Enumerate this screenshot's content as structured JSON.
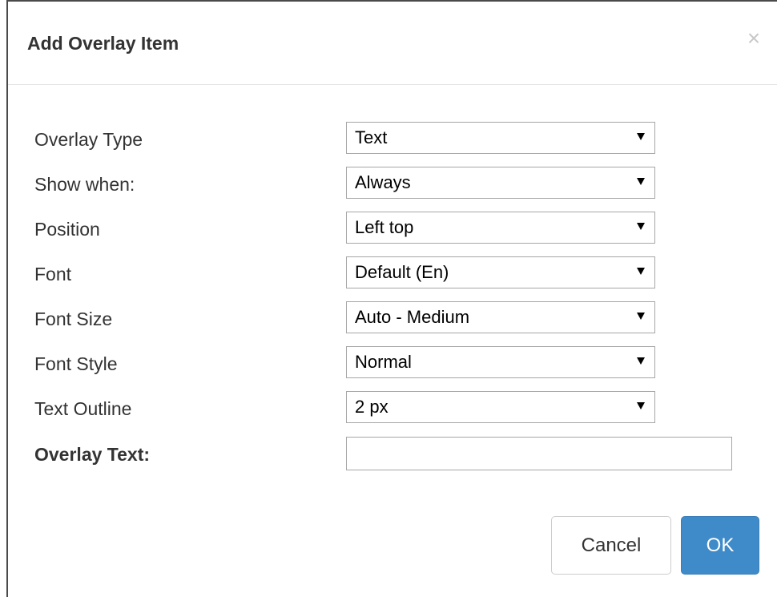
{
  "dialog": {
    "title": "Add Overlay Item",
    "close_glyph": "×",
    "close_icon": "close-icon"
  },
  "form": {
    "overlay_type": {
      "label": "Overlay Type",
      "value": "Text"
    },
    "show_when": {
      "label": "Show when:",
      "value": "Always"
    },
    "position": {
      "label": "Position",
      "value": "Left top"
    },
    "font": {
      "label": "Font",
      "value": "Default (En)"
    },
    "font_size": {
      "label": "Font Size",
      "value": "Auto - Medium"
    },
    "font_style": {
      "label": "Font Style",
      "value": "Normal"
    },
    "text_outline": {
      "label": "Text Outline",
      "value": "2 px"
    },
    "overlay_text": {
      "label": "Overlay Text:",
      "value": ""
    }
  },
  "footer": {
    "cancel_label": "Cancel",
    "ok_label": "OK"
  },
  "colors": {
    "primary_button": "#3f8ac8",
    "close_icon": "#c8c8c8",
    "border": "#a6a6a6"
  }
}
